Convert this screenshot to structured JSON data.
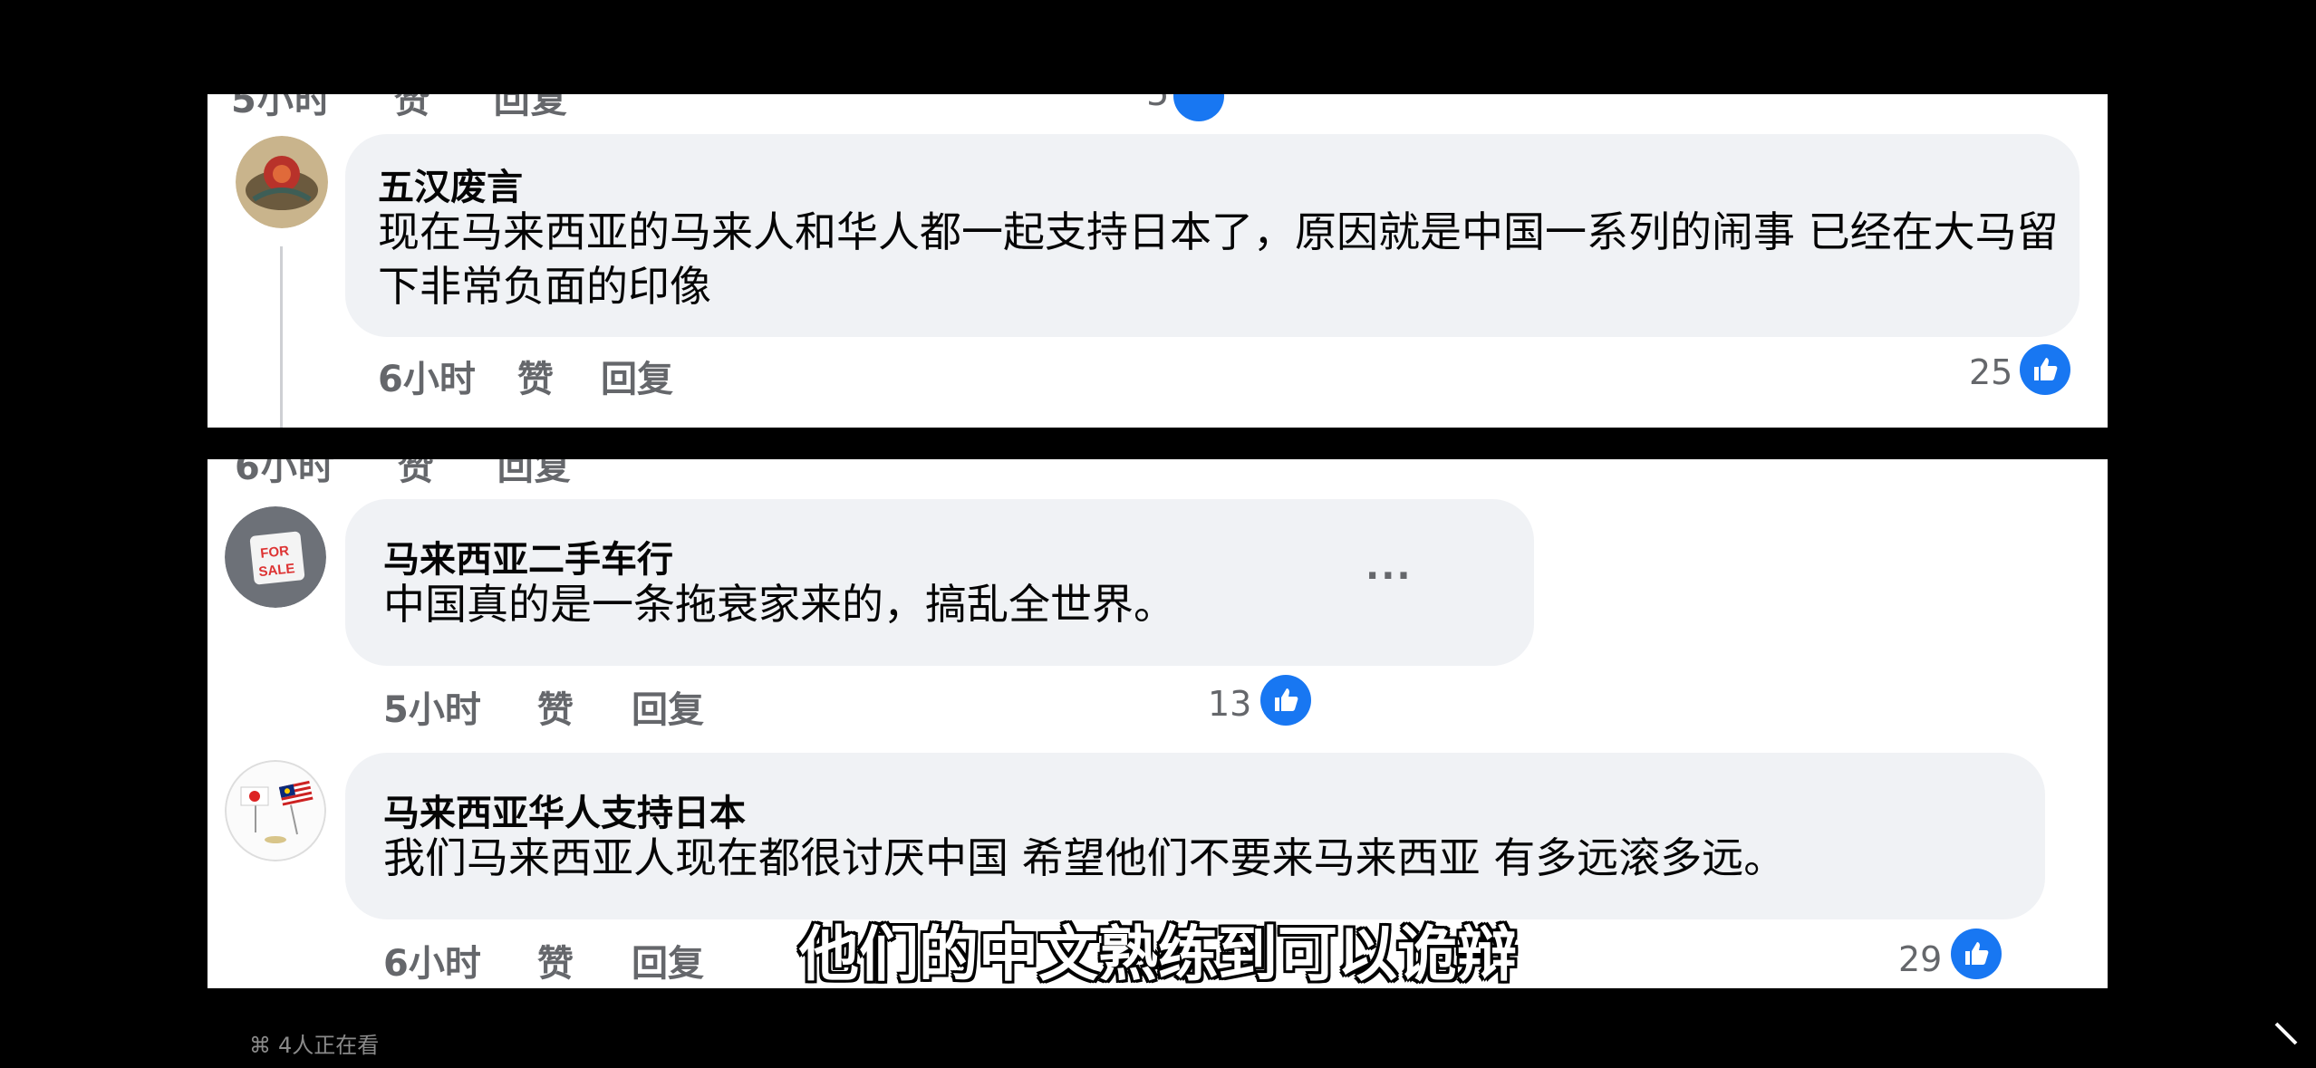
{
  "panel_top": {
    "clipped_prev": {
      "actions": [
        "5小时",
        "赞",
        "回复"
      ],
      "likes": "5"
    },
    "comment": {
      "author": "五汉废言",
      "text": "现在马来西亚的马来人和华人都一起支持日本了，原因就是中国一系列的闹事 已经在大马留下非常负面的印像",
      "time": "6小时",
      "like_action": "赞",
      "reply_action": "回复",
      "likes": "25"
    }
  },
  "panel_bottom": {
    "clipped_prev": {
      "actions": [
        "6小时",
        "赞",
        "回复"
      ]
    },
    "comments": [
      {
        "author": "马来西亚二手车行",
        "text": "中国真的是一条拖衰家来的，搞乱全世界。",
        "time": "5小时",
        "like_action": "赞",
        "reply_action": "回复",
        "likes": "13",
        "more": "···"
      },
      {
        "author": "马来西亚华人支持日本",
        "text": "我们马来西亚人现在都很讨厌中国 希望他们不要来马来西亚 有多远滚多远。",
        "time": "6小时",
        "like_action": "赞",
        "reply_action": "回复",
        "likes": "29"
      }
    ]
  },
  "subtitle": "他们的中文熟练到可以诡辩",
  "viewers": "4人正在看",
  "colors": {
    "like_blue": "#1877f2",
    "bubble": "#f0f2f5",
    "meta_gray": "#65676b"
  }
}
